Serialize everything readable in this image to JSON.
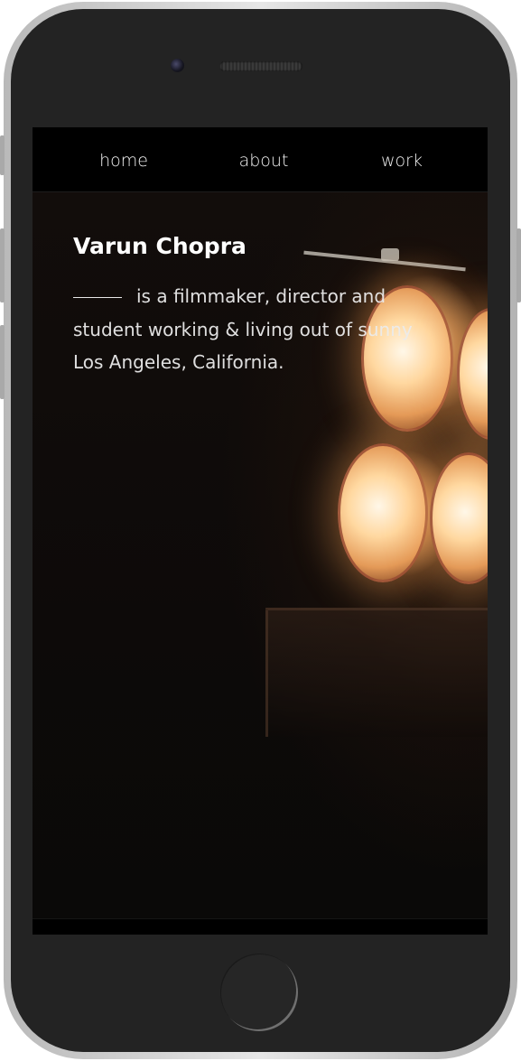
{
  "nav": {
    "items": [
      {
        "label": "home"
      },
      {
        "label": "about"
      },
      {
        "label": "work"
      }
    ]
  },
  "hero": {
    "name": "Varun Chopra",
    "bio": "is a filmmaker, director and student working & living out of sunny Los Angeles, California."
  },
  "colors": {
    "background": "#000000",
    "text": "#ffffff",
    "device": "#232323"
  },
  "icons": [
    "camera-icon",
    "speaker-grille",
    "home-button"
  ]
}
